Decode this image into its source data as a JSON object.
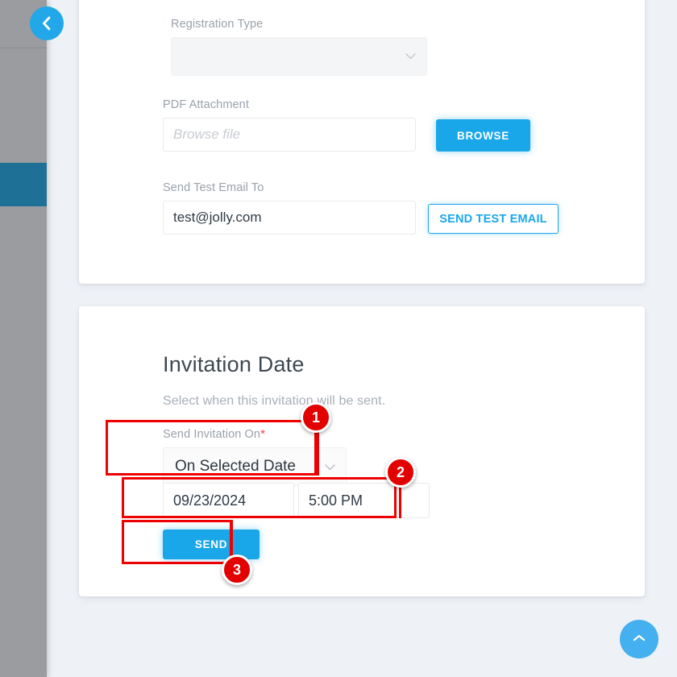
{
  "sidebar": {
    "back_button_icon": "chevron-left-icon",
    "active_item_label": ""
  },
  "email_card": {
    "registration_type": {
      "label": "Registration Type",
      "value": "",
      "chevron_icon": "chevron-down-icon"
    },
    "pdf_attachment": {
      "label": "PDF Attachment",
      "value": "",
      "placeholder": "Browse file",
      "browse_button": "BROWSE"
    },
    "send_test_email": {
      "label": "Send Test Email To",
      "value": "test@jolly.com",
      "button": "SEND TEST EMAIL"
    }
  },
  "date_card": {
    "title": "Invitation Date",
    "subtitle": "Select when this invitation will be sent.",
    "send_invitation_on": {
      "label": "Send Invitation On",
      "required_marker": "*",
      "value": "On Selected Date",
      "chevron_icon": "chevron-down-icon"
    },
    "date_value": "09/23/2024",
    "time_value": "5:00 PM",
    "send_button": "SEND"
  },
  "annotations": {
    "badge_1": "1",
    "badge_2": "2",
    "badge_3": "3"
  },
  "fab": {
    "scroll_top_icon": "chevron-up-icon"
  },
  "colors": {
    "accent_blue": "#1aa7ea",
    "fab_blue": "#45b0ef",
    "sidebar_active": "#1f7096",
    "annotation_red": "#ef0000",
    "page_bg": "#eef1f6",
    "required_red": "#f0404a"
  }
}
